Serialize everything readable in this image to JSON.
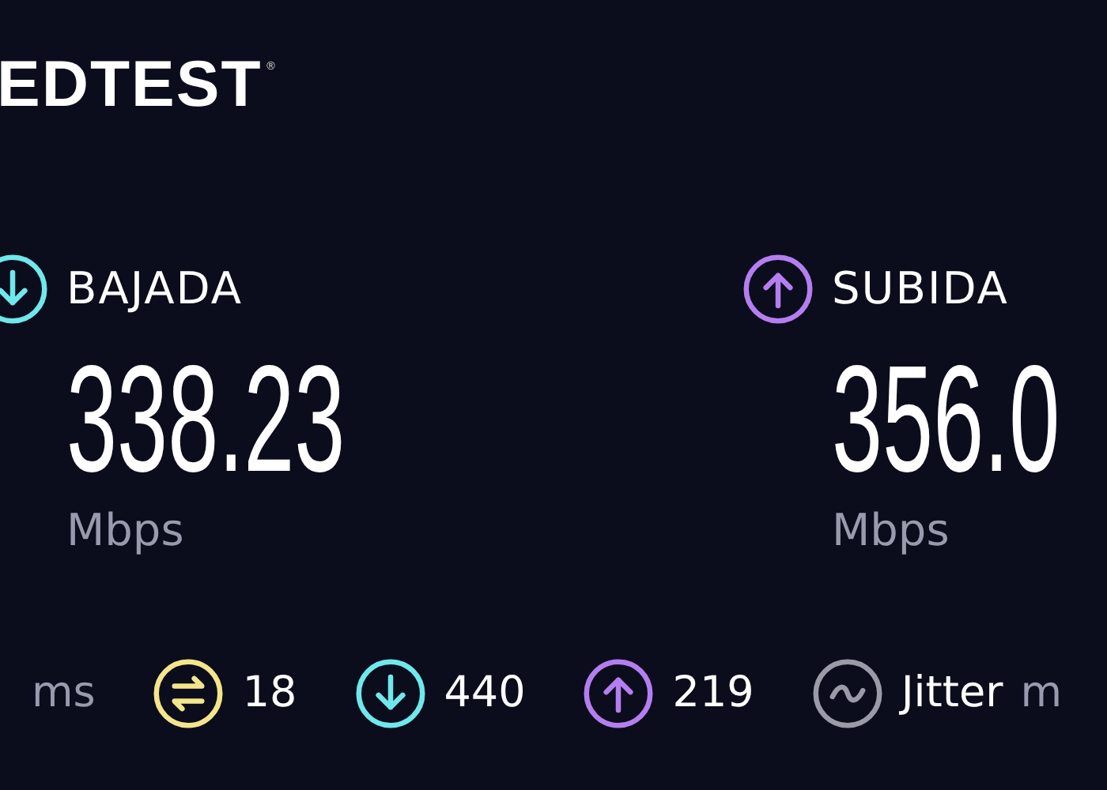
{
  "logo": {
    "text": "EDTEST",
    "mark": "®"
  },
  "speeds": [
    {
      "kind": "download",
      "label": "BAJADA",
      "value": "338.23",
      "unit": "Mbps",
      "color": "#6fe8ec"
    },
    {
      "kind": "upload",
      "label": "SUBIDA",
      "value": "356.0",
      "unit": "Mbps",
      "color": "#b57ef0"
    }
  ],
  "stats": [
    {
      "kind": "unit",
      "unit": "ms"
    },
    {
      "kind": "swap",
      "value": "18",
      "color": "#f5e58a"
    },
    {
      "kind": "download",
      "value": "440",
      "color": "#6fe8ec"
    },
    {
      "kind": "upload",
      "value": "219",
      "color": "#b57ef0"
    },
    {
      "kind": "wave",
      "value": "Jitter",
      "unit": "m",
      "color": "#9b9ba8"
    }
  ]
}
